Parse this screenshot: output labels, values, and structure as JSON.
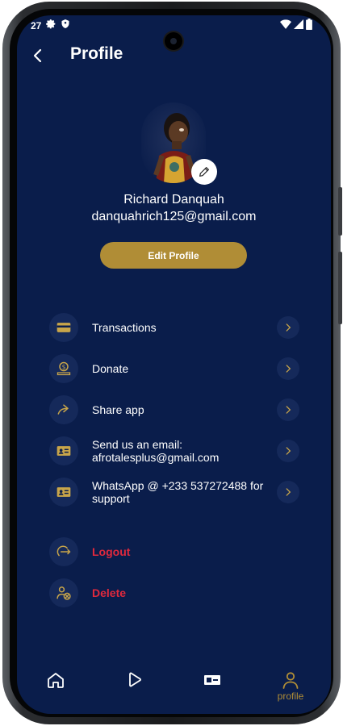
{
  "status_bar": {
    "time": "27"
  },
  "header": {
    "title": "Profile"
  },
  "profile": {
    "name": "Richard Danquah",
    "email": "danquahrich125@gmail.com",
    "edit_button_label": "Edit Profile"
  },
  "menu": [
    {
      "label": "Transactions",
      "icon": "credit-card-icon"
    },
    {
      "label": "Donate",
      "icon": "donate-icon"
    },
    {
      "label": "Share app",
      "icon": "share-icon"
    },
    {
      "label": "Send us an email: afrotalesplus@gmail.com",
      "icon": "contact-card-icon"
    },
    {
      "label": "WhatsApp @ +233 537272488 for support",
      "icon": "contact-card-icon"
    }
  ],
  "account_actions": [
    {
      "label": "Logout",
      "icon": "logout-icon"
    },
    {
      "label": "Delete",
      "icon": "delete-user-icon"
    }
  ],
  "bottom_nav": [
    {
      "icon": "home-icon",
      "label": ""
    },
    {
      "icon": "play-icon",
      "label": ""
    },
    {
      "icon": "ticket-icon",
      "label": ""
    },
    {
      "icon": "profile-icon",
      "label": "profile",
      "active": true
    }
  ],
  "colors": {
    "background": "#0a1d4b",
    "accent_gold": "#b08d36",
    "danger": "#e0293d",
    "icon_circle": "#15295a"
  }
}
